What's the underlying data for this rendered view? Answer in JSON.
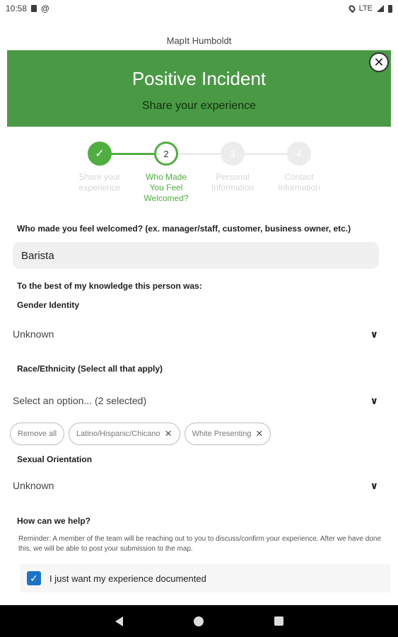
{
  "status_bar": {
    "time": "10:58",
    "network": "LTE",
    "icons": [
      "sd-card-icon",
      "at-sign-icon",
      "location-icon",
      "signal-icon",
      "battery-icon"
    ]
  },
  "behind": {
    "title": "MapIt Humboldt"
  },
  "modal": {
    "title": "Positive Incident",
    "subtitle": "Share your experience",
    "close_icon": "✕",
    "header_color": "#4a9a45"
  },
  "stepper": {
    "active_color": "#4fae3f",
    "steps": [
      {
        "number": "✓",
        "label": [
          "Share your",
          "experience"
        ],
        "state": "done"
      },
      {
        "number": "2",
        "label": [
          "Who Made",
          "You Feel",
          "Welcomed?"
        ],
        "state": "active"
      },
      {
        "number": "3",
        "label": [
          "Personal",
          "Information"
        ],
        "state": "todo"
      },
      {
        "number": "4",
        "label": [
          "Contact",
          "Information"
        ],
        "state": "todo"
      }
    ]
  },
  "form": {
    "who_label": "Who made you feel welcomed? (ex. manager/staff,  customer, business owner, etc.)",
    "who_value": "Barista",
    "knowledge_label": "To the best of my knowledge this person was:",
    "gender_label": "Gender Identity",
    "gender_value": "Unknown",
    "race_label": "Race/Ethnicity (Select all that apply)",
    "race_value": "Select an option... (2 selected)",
    "chips": {
      "remove_all": "Remove all",
      "selected": [
        "Latino/Hispanic/Chicano",
        "White Presenting"
      ]
    },
    "orientation_label": "Sexual Orientation",
    "orientation_value": "Unknown",
    "help_label": "How can we help?",
    "reminder": "Reminder: A member of the team will be reaching out to you to discuss/confirm your experience. After we have done this, we will be able to post your submission to the map.",
    "checkbox_label": "I just want my experience documented",
    "checkbox_checked": true
  },
  "nav_bar": {
    "icons": [
      "back-icon",
      "home-icon",
      "recents-icon"
    ]
  }
}
